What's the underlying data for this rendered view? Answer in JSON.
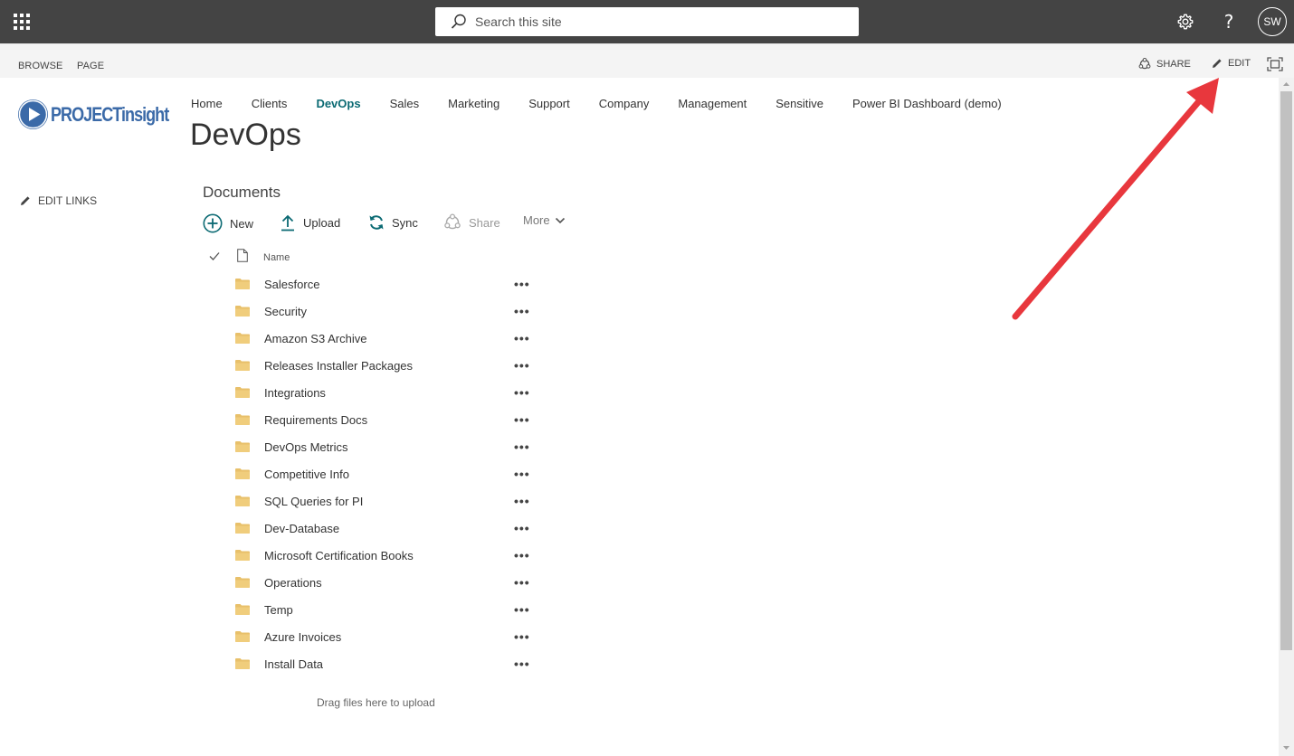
{
  "suite": {
    "search_placeholder": "Search this site",
    "help_glyph": "?",
    "avatar_initials": "SW"
  },
  "ribbon": {
    "tabs": [
      "BROWSE",
      "PAGE"
    ],
    "share_label": "SHARE",
    "edit_label": "EDIT"
  },
  "logo": {
    "part1": "PROJECT",
    "part2": "insight"
  },
  "nav": {
    "items": [
      "Home",
      "Clients",
      "DevOps",
      "Sales",
      "Marketing",
      "Support",
      "Company",
      "Management",
      "Sensitive",
      "Power BI Dashboard (demo)"
    ],
    "active": "DevOps"
  },
  "page": {
    "title": "DevOps"
  },
  "left": {
    "edit_links": "EDIT LINKS"
  },
  "documents": {
    "title": "Documents",
    "commands": {
      "new": "New",
      "upload": "Upload",
      "sync": "Sync",
      "share": "Share",
      "more": "More"
    },
    "column_name": "Name",
    "folders": [
      "Salesforce",
      "Security",
      "Amazon S3 Archive",
      "Releases Installer Packages",
      "Integrations",
      "Requirements Docs",
      "DevOps Metrics",
      "Competitive Info",
      "SQL Queries for PI",
      "Dev-Database",
      "Microsoft Certification Books",
      "Operations",
      "Temp",
      "Azure Invoices",
      "Install Data"
    ],
    "drag_hint": "Drag files here to upload"
  },
  "colors": {
    "suite_bar": "#444444",
    "accent": "#0b6a73",
    "logo_blue": "#3b6aa8",
    "folder": "#e8c06a",
    "annotation_arrow": "#e8373d"
  }
}
